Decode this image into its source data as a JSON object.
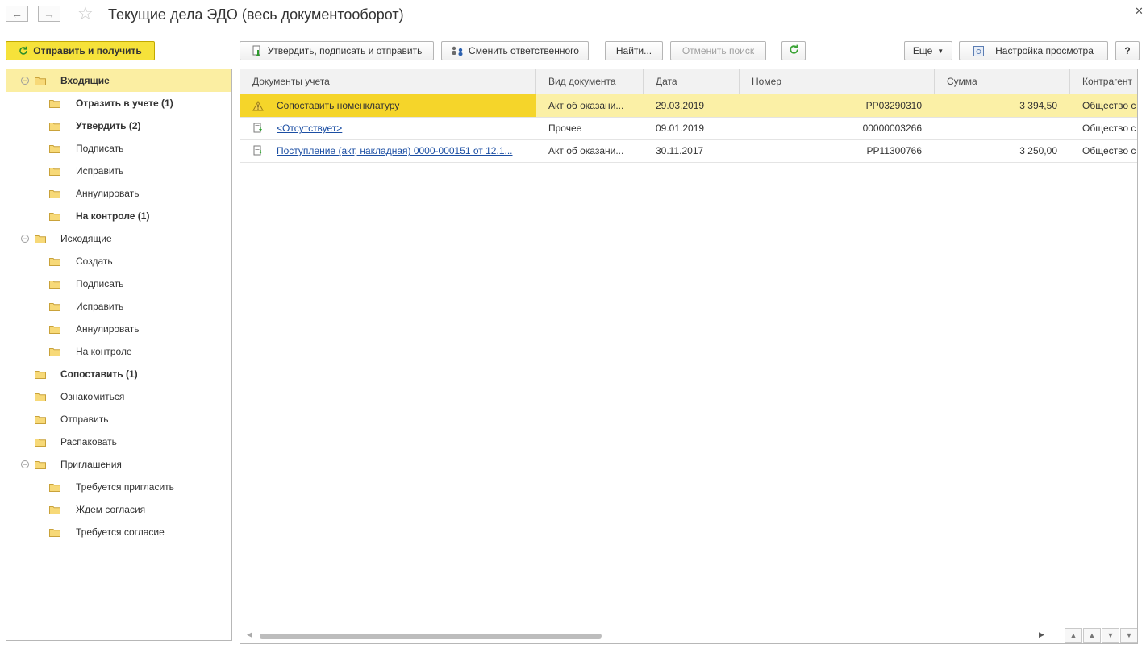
{
  "window": {
    "title": "Текущие дела ЭДО (весь документооборот)"
  },
  "toolbar": {
    "send_receive": "Отправить и получить",
    "approve_sign_send": "Утвердить, подписать и отправить",
    "change_responsible": "Сменить ответственного",
    "find": "Найти...",
    "cancel_search": "Отменить поиск",
    "more": "Еще",
    "view_settings": "Настройка просмотра",
    "help": "?"
  },
  "tree": [
    {
      "label": "Входящие",
      "bold": true,
      "selected": true,
      "level": 0,
      "toggle": "⊖"
    },
    {
      "label": "Отразить в учете (1)",
      "bold": true,
      "level": 1
    },
    {
      "label": "Утвердить (2)",
      "bold": true,
      "level": 1
    },
    {
      "label": "Подписать",
      "level": 1
    },
    {
      "label": "Исправить",
      "level": 1
    },
    {
      "label": "Аннулировать",
      "level": 1
    },
    {
      "label": "На контроле (1)",
      "bold": true,
      "level": 1
    },
    {
      "label": "Исходящие",
      "level": 0,
      "toggle": "⊖"
    },
    {
      "label": "Создать",
      "level": 1
    },
    {
      "label": "Подписать",
      "level": 1
    },
    {
      "label": "Исправить",
      "level": 1
    },
    {
      "label": "Аннулировать",
      "level": 1
    },
    {
      "label": "На контроле",
      "level": 1
    },
    {
      "label": "Сопоставить (1)",
      "bold": true,
      "level": 0
    },
    {
      "label": "Ознакомиться",
      "level": 0
    },
    {
      "label": "Отправить",
      "level": 0
    },
    {
      "label": "Распаковать",
      "level": 0
    },
    {
      "label": "Приглашения",
      "level": 0,
      "toggle": "⊖"
    },
    {
      "label": "Требуется пригласить",
      "level": 1
    },
    {
      "label": "Ждем согласия",
      "level": 1
    },
    {
      "label": "Требуется согласие",
      "level": 1
    }
  ],
  "grid": {
    "columns": [
      "Документы учета",
      "Вид документа",
      "Дата",
      "Номер",
      "Сумма",
      "Контрагент"
    ],
    "rows": [
      {
        "doc": "Сопоставить номенклатуру",
        "icon": "warning-icon",
        "kind": "Акт об оказани...",
        "date": "29.03.2019",
        "number": "РР03290310",
        "sum": "3 394,50",
        "counterparty": "Общество с",
        "selected": true
      },
      {
        "doc": "<Отсутствует>",
        "icon": "document-incoming-icon",
        "kind": "Прочее",
        "date": "09.01.2019",
        "number": "00000003266",
        "sum": "",
        "counterparty": "Общество с"
      },
      {
        "doc": "Поступление (акт, накладная) 0000-000151 от 12.1...",
        "icon": "document-incoming-icon",
        "kind": "Акт об оказани...",
        "date": "30.11.2017",
        "number": "РР11300766",
        "sum": "3 250,00",
        "counterparty": "Общество с"
      }
    ]
  },
  "colors": {
    "accent_yellow": "#f6e23a",
    "row_selected": "#fbf0a6",
    "link": "#1b4ea3",
    "refresh_green": "#3aa335"
  }
}
